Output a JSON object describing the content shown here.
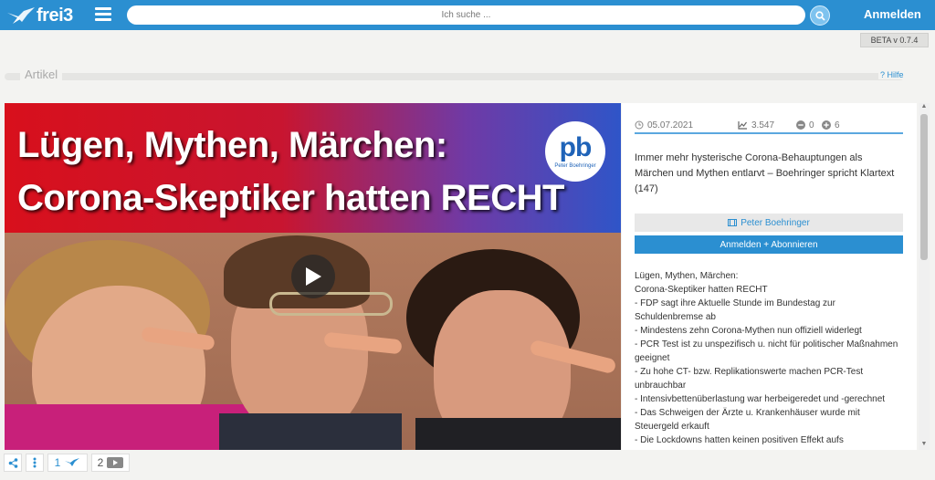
{
  "header": {
    "logo_text": "frei3",
    "search_placeholder": "Ich suche ...",
    "login_label": "Anmelden"
  },
  "version": "BETA v 0.7.4",
  "section": {
    "title": "Artikel",
    "help_label": "? Hilfe"
  },
  "thumbnail": {
    "headline_line1": "Lügen, Mythen, Märchen:",
    "headline_line2": "Corona-Skeptiker hatten RECHT",
    "logo_mark": "pb",
    "logo_name": "Peter Boehringer"
  },
  "stats": {
    "date": "05.07.2021",
    "views": "3.547",
    "dislikes": "0",
    "likes": "6"
  },
  "article": {
    "title": "Immer mehr hysterische Corona-Behauptungen als Märchen und Mythen entlarvt – Boehringer spricht Klartext (147)",
    "channel_label": "Peter Boehringer",
    "subscribe_label": "Anmelden + Abonnieren",
    "description_lines": [
      "Lügen, Mythen, Märchen:",
      "Corona-Skeptiker hatten RECHT",
      "- FDP sagt ihre Aktuelle Stunde im Bundestag zur",
      "Schuldenbremse ab",
      "- Mindestens zehn Corona-Mythen nun offiziell widerlegt",
      "- PCR Test ist zu unspezifisch u. nicht für politischer Maßnahmen",
      "geeignet",
      "- Zu hohe CT- bzw. Replikationswerte machen PCR-Test",
      "unbrauchbar",
      "- Intensivbettenüberlastung war herbeigeredet und -gerechnet",
      "- Das Schweigen der Ärzte u. Krankenhäuser wurde mit",
      "Steuergeld erkauft",
      "- Die Lockdowns hatten keinen positiven Effekt aufs"
    ]
  },
  "pagination": {
    "page1": "1",
    "page2": "2"
  },
  "colors": {
    "brand_blue": "#2b8fd1",
    "background": "#f3f3f1"
  },
  "icons": [
    "bird-logo-icon",
    "menu-icon",
    "search-icon",
    "clock-icon",
    "chart-icon",
    "minus-circle-icon",
    "plus-circle-icon",
    "film-icon",
    "play-icon",
    "share-icon",
    "more-vertical-icon",
    "bird-icon",
    "video-icon"
  ]
}
